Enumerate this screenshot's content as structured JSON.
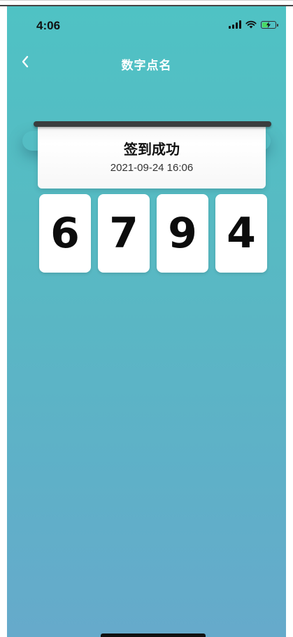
{
  "status_bar": {
    "time": "4:06",
    "signal_icon": "cellular-signal-icon",
    "wifi_icon": "wifi-icon",
    "battery_icon": "battery-charging-icon",
    "battery_color": "#4cd964"
  },
  "navbar": {
    "back_icon": "chevron-left-icon",
    "title": "数字点名"
  },
  "checkin": {
    "title": "签到成功",
    "timestamp": "2021-09-24 16:06",
    "digits": [
      "6",
      "7",
      "9",
      "4"
    ]
  },
  "colors": {
    "background_top": "#4fc2c4",
    "background_bottom": "#66aacb",
    "card": "#ffffff",
    "text_dark": "#111111"
  }
}
